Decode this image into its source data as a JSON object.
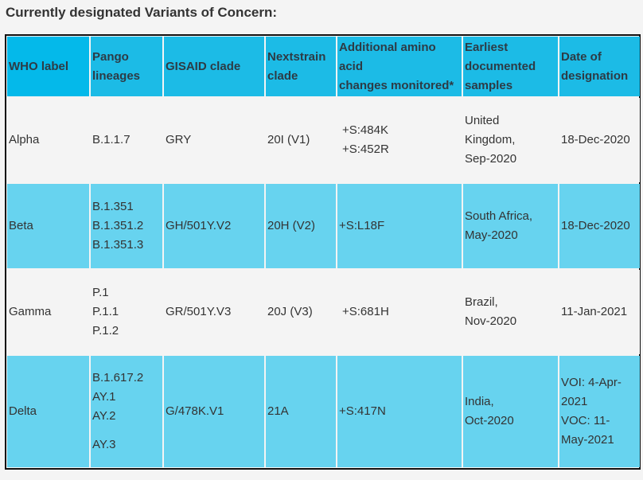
{
  "title": "Currently designated Variants of Concern:",
  "colors": {
    "header_bg": "#1cbbe6",
    "header_first_bg": "#04b9ea",
    "alt_row_bg": "#67d3ef",
    "row_bg": "#f4f4f4",
    "text": "#333333"
  },
  "table": {
    "headers": [
      [
        "WHO label"
      ],
      [
        "Pango",
        "lineages"
      ],
      [
        "GISAID clade"
      ],
      [
        "Nextstrain",
        "clade"
      ],
      [
        "Additional amino",
        "acid",
        "changes monitored*"
      ],
      [
        "Earliest",
        "documented",
        "samples"
      ],
      [
        "Date of",
        "designation"
      ]
    ],
    "rows": [
      {
        "who_label": "Alpha",
        "pango": [
          "B.1.1.7"
        ],
        "gisaid": "GRY",
        "nextstrain": "20I (V1)",
        "amino": [
          "+S:484K",
          "+S:452R"
        ],
        "earliest": [
          "United",
          "Kingdom,",
          "Sep-2020"
        ],
        "date": [
          "18-Dec-2020"
        ]
      },
      {
        "who_label": "Beta",
        "pango": [
          "B.1.351",
          "B.1.351.2",
          "B.1.351.3"
        ],
        "gisaid": "GH/501Y.V2",
        "nextstrain": "20H (V2)",
        "amino": [
          "+S:L18F"
        ],
        "earliest": [
          "South Africa,",
          "May-2020"
        ],
        "date": [
          "18-Dec-2020"
        ]
      },
      {
        "who_label": "Gamma",
        "pango": [
          "P.1",
          "P.1.1",
          "P.1.2"
        ],
        "gisaid": "GR/501Y.V3",
        "nextstrain": "20J (V3)",
        "amino": [
          "+S:681H"
        ],
        "earliest": [
          "Brazil,",
          "Nov-2020"
        ],
        "date": [
          "11-Jan-2021"
        ]
      },
      {
        "who_label": "Delta",
        "pango": [
          "B.1.617.2",
          "AY.1",
          "AY.2",
          "AY.3"
        ],
        "gisaid": "G/478K.V1",
        "nextstrain": "21A",
        "amino": [
          "+S:417N"
        ],
        "earliest": [
          "India,",
          "Oct-2020"
        ],
        "date": [
          "VOI: 4-Apr-",
          "2021",
          "VOC: 11-",
          "May-2021"
        ]
      }
    ]
  }
}
